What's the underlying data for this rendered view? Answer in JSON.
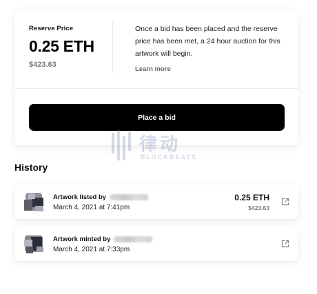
{
  "reserve": {
    "label": "Reserve Price",
    "amount": "0.25 ETH",
    "usd": "$423.63",
    "note": "Once a bid has been placed and the reserve price has been met, a 24 hour auction for this artwork will begin.",
    "learn_more": "Learn more"
  },
  "bid_button": {
    "label": "Place a bid"
  },
  "watermark": {
    "cn": "律动",
    "en": "BLOCKBEATS"
  },
  "history": {
    "title": "History",
    "events": [
      {
        "action": "Artwork listed by",
        "date": "March 4, 2021 at 7:41pm",
        "price_eth": "0.25 ETH",
        "price_usd": "$423.63",
        "link_icon": "external-link-icon"
      },
      {
        "action": "Artwork minted by",
        "date": "March 4, 2021 at 7:33pm",
        "link_icon": "external-link-icon"
      }
    ]
  },
  "colors": {
    "button_bg": "#000000",
    "muted_text": "#7a7a7a",
    "card_bg": "#ffffff"
  }
}
